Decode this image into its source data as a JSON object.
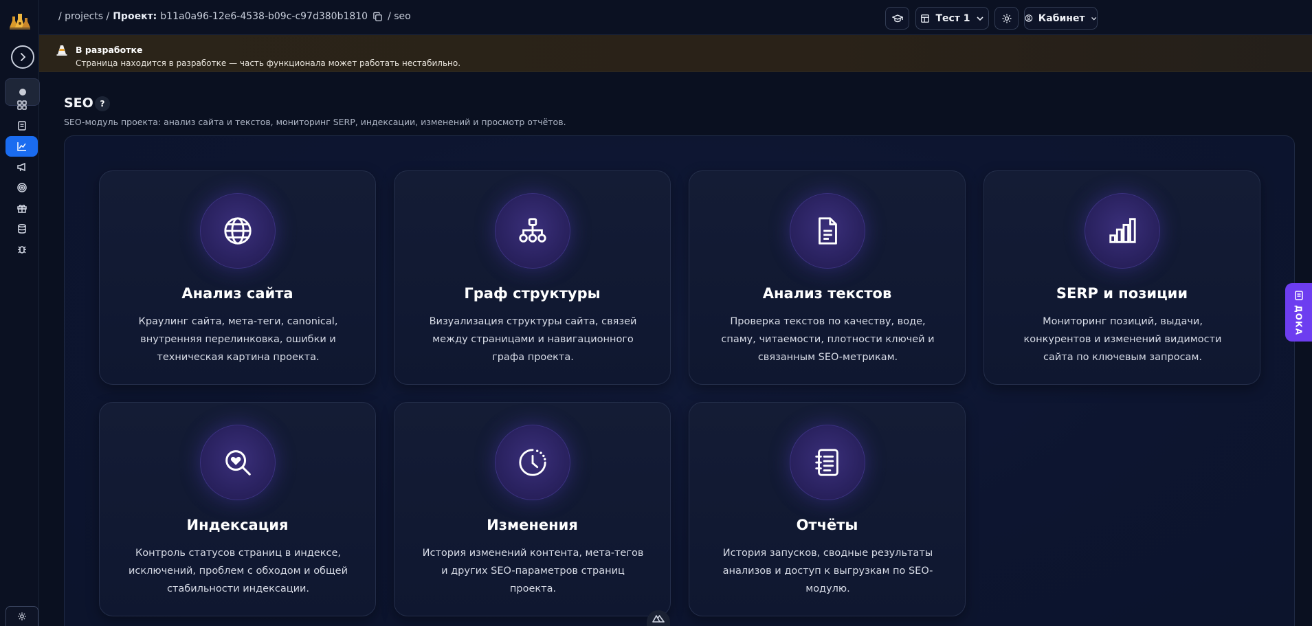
{
  "breadcrumb": {
    "projects": "/ projects /",
    "project_label": "Проект:",
    "project_id": "b11a0a96-12e6-4538-b09c-c97d380b1810",
    "section": "/ seo"
  },
  "topbar": {
    "project_select": "Тест 1",
    "account": "Кабинет"
  },
  "banner": {
    "title": "В разработке",
    "text": "Страница находится в разработке — часть функционала может работать нестабильно."
  },
  "page": {
    "title": "SEO",
    "help": "?",
    "subtitle": "SEO-модуль проекта: анализ сайта и текстов, мониторинг SERP, индексации, изменений и просмотр отчётов."
  },
  "cards": [
    {
      "title": "Анализ сайта",
      "desc": "Краулинг сайта, мета-теги, canonical, внутренняя перелинковка, ошибки и техническая картина проекта.",
      "icon": "globe-icon"
    },
    {
      "title": "Граф структуры",
      "desc": "Визуализация структуры сайта, связей между страницами и навигационного графа проекта.",
      "icon": "sitemap-icon"
    },
    {
      "title": "Анализ текстов",
      "desc": "Проверка текстов по качеству, воде, спаму, читаемости, плотности ключей и связанным SEO-метрикам.",
      "icon": "document-icon"
    },
    {
      "title": "SERP и позиции",
      "desc": "Мониторинг позиций, выдачи, конкурентов и изменений видимости сайта по ключевым запросам.",
      "icon": "bar-chart-icon"
    },
    {
      "title": "Индексация",
      "desc": "Контроль статусов страниц в индексе, исключений, проблем с обходом и общей стабильности индексации.",
      "icon": "search-heart-icon"
    },
    {
      "title": "Изменения",
      "desc": "История изменений контента, мета-тегов и других SEO-параметров страниц проекта.",
      "icon": "history-icon"
    },
    {
      "title": "Отчёты",
      "desc": "История запусков, сводные результаты анализов и доступ к выгрузкам по SEO-модулю.",
      "icon": "report-icon"
    }
  ],
  "doka": {
    "label": "ДОКА"
  },
  "colors": {
    "accent": "#1a6cf0",
    "doka": "#6d3df0",
    "icon_circle": "#2a2260",
    "background": "#0a1020"
  }
}
